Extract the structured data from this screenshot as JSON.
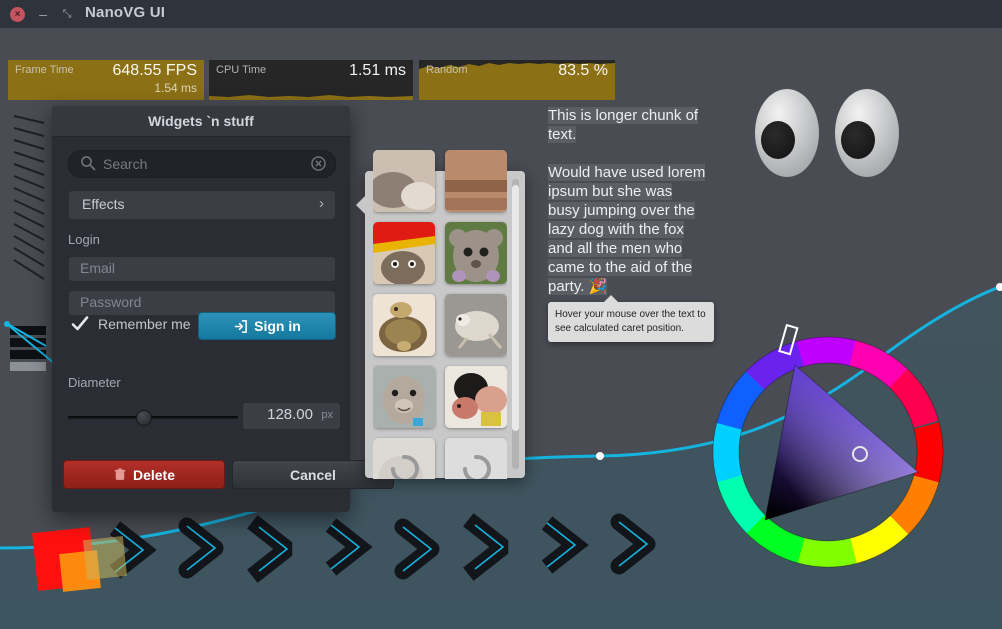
{
  "window": {
    "title": "NanoVG UI",
    "close_icon": "close-icon",
    "minimize_icon": "minimize-icon",
    "maximize_icon": "maximize-icon",
    "close_glyph": "×",
    "minimize_glyph": "–",
    "maximize_glyph": "⤡"
  },
  "perf_graphs": [
    {
      "name": "Frame Time",
      "value": "648.55 FPS",
      "secondary": "1.54 ms",
      "color": "#8c7015"
    },
    {
      "name": "CPU Time",
      "value": "1.51 ms",
      "secondary": "",
      "color": "#262626"
    },
    {
      "name": "Random",
      "value": "83.5 %",
      "secondary": "",
      "color": "#8c7015"
    }
  ],
  "widgets_window": {
    "title": "Widgets `n stuff",
    "search": {
      "placeholder": "Search",
      "icon": "search-icon",
      "clear_icon": "clear-icon"
    },
    "dropdown": {
      "value": "Effects",
      "chevron": "›"
    },
    "login": {
      "label": "Login",
      "email_placeholder": "Email",
      "password_placeholder": "Password",
      "remember_label": "Remember me",
      "remember_checked": true,
      "check_glyph": "✔",
      "signin_label": "Sign in",
      "signin_icon": "login-icon"
    },
    "diameter": {
      "label": "Diameter",
      "value": "128.00",
      "unit": "px",
      "slider_percent": 44
    },
    "actions": {
      "delete_label": "Delete",
      "delete_icon": "trash-icon",
      "cancel_label": "Cancel"
    }
  },
  "thumbnails": {
    "scroll_position": "near-top",
    "items": [
      {
        "name": "thumbnail-cat-top",
        "alt": "cat photo (clipped)"
      },
      {
        "name": "thumbnail-brick-top",
        "alt": "brick photo (clipped)"
      },
      {
        "name": "thumbnail-cat-blanket",
        "alt": "cat under red blanket"
      },
      {
        "name": "thumbnail-kinkajou",
        "alt": "kinkajou"
      },
      {
        "name": "thumbnail-turtles",
        "alt": "turtle on turtle"
      },
      {
        "name": "thumbnail-hedgehog",
        "alt": "small rodent on stone"
      },
      {
        "name": "thumbnail-seal",
        "alt": "seal face"
      },
      {
        "name": "thumbnail-guineapig",
        "alt": "guinea pig in blanket"
      },
      {
        "name": "thumbnail-loading-1",
        "alt": "loading spinner over image"
      },
      {
        "name": "thumbnail-loading-2",
        "alt": "loading spinner"
      }
    ]
  },
  "paragraph": {
    "line1": "This is longer chunk of",
    "line2": "text.",
    "line3": "Would have used lorem",
    "line4": "ipsum but she   was",
    "line5": "busy jumping over the",
    "line6": "lazy dog with the fox",
    "line7": "and all the men who",
    "line8": "came to the aid of the",
    "line9": "party. 🎉"
  },
  "tooltip": {
    "line1": "Hover your mouse over the text to",
    "line2": "see calculated caret position."
  },
  "eyes": {
    "name": "googly-eyes"
  },
  "color_wheel": {
    "name": "hue-saturation-color-wheel",
    "hue_marker_angle_deg": -75,
    "selected_point": "inside-triangle"
  },
  "colors": {
    "client_bg_top": "#4a4c54",
    "client_bg_bottom": "#3d5560",
    "accent_cyan": "#15b4e0",
    "accent_red": "#b13028",
    "accent_blue": "#16789e",
    "graph_gold": "#8c7015",
    "titlebar": "#2f333c"
  }
}
